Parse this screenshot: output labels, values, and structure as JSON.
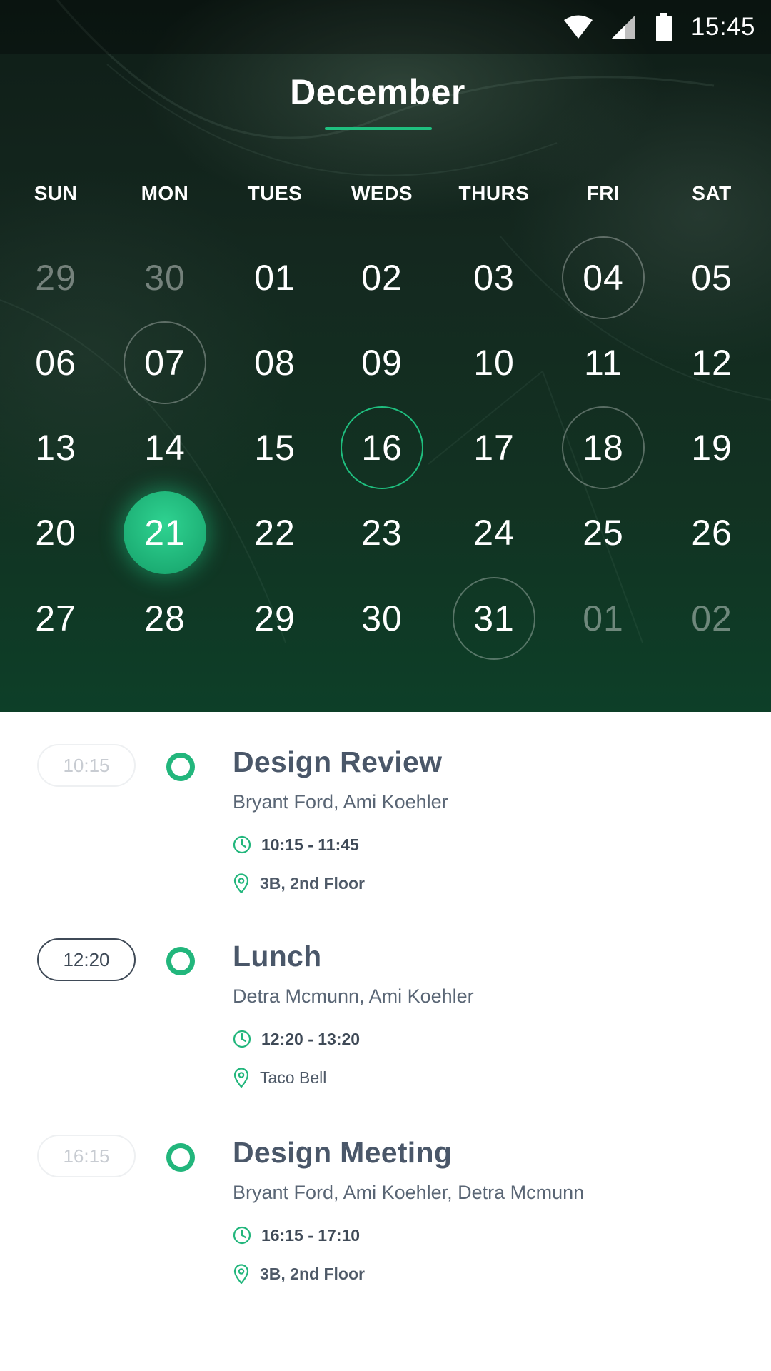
{
  "status_bar": {
    "time": "15:45",
    "icons": [
      "wifi-icon",
      "signal-icon",
      "battery-icon"
    ]
  },
  "calendar": {
    "month": "December",
    "weekdays": [
      "SUN",
      "MON",
      "TUES",
      "WEDS",
      "THURS",
      "FRI",
      "SAT"
    ],
    "accent_color": "#1fbf7f",
    "weeks": [
      [
        {
          "label": "29",
          "in_month": false
        },
        {
          "label": "30",
          "in_month": false
        },
        {
          "label": "01",
          "in_month": true
        },
        {
          "label": "02",
          "in_month": true
        },
        {
          "label": "03",
          "in_month": true
        },
        {
          "label": "04",
          "in_month": true,
          "has_event": true
        },
        {
          "label": "05",
          "in_month": true
        }
      ],
      [
        {
          "label": "06",
          "in_month": true
        },
        {
          "label": "07",
          "in_month": true,
          "has_event": true
        },
        {
          "label": "08",
          "in_month": true
        },
        {
          "label": "09",
          "in_month": true
        },
        {
          "label": "10",
          "in_month": true
        },
        {
          "label": "11",
          "in_month": true
        },
        {
          "label": "12",
          "in_month": true
        }
      ],
      [
        {
          "label": "13",
          "in_month": true
        },
        {
          "label": "14",
          "in_month": true
        },
        {
          "label": "15",
          "in_month": true
        },
        {
          "label": "16",
          "in_month": true,
          "has_event": true,
          "highlight": "green"
        },
        {
          "label": "17",
          "in_month": true
        },
        {
          "label": "18",
          "in_month": true,
          "has_event": true
        },
        {
          "label": "19",
          "in_month": true
        }
      ],
      [
        {
          "label": "20",
          "in_month": true
        },
        {
          "label": "21",
          "in_month": true,
          "selected": true
        },
        {
          "label": "22",
          "in_month": true
        },
        {
          "label": "23",
          "in_month": true
        },
        {
          "label": "24",
          "in_month": true
        },
        {
          "label": "25",
          "in_month": true
        },
        {
          "label": "26",
          "in_month": true
        }
      ],
      [
        {
          "label": "27",
          "in_month": true
        },
        {
          "label": "28",
          "in_month": true
        },
        {
          "label": "29",
          "in_month": true
        },
        {
          "label": "30",
          "in_month": true
        },
        {
          "label": "31",
          "in_month": true,
          "has_event": true
        },
        {
          "label": "01",
          "in_month": false
        },
        {
          "label": "02",
          "in_month": false
        }
      ]
    ]
  },
  "agenda": [
    {
      "time_tag": "10:15",
      "active": false,
      "title": "Design Review",
      "people": "Bryant Ford, Ami Koehler",
      "time_range": "10:15 - 11:45",
      "location": "3B, 2nd Floor"
    },
    {
      "time_tag": "12:20",
      "active": true,
      "title": "Lunch",
      "people": "Detra Mcmunn, Ami Koehler",
      "time_range": "12:20 - 13:20",
      "location": "Taco Bell"
    },
    {
      "time_tag": "16:15",
      "active": false,
      "title": "Design Meeting",
      "people": "Bryant Ford, Ami Koehler, Detra Mcmunn",
      "time_range": "16:15 - 17:10",
      "location": "3B, 2nd Floor"
    }
  ]
}
